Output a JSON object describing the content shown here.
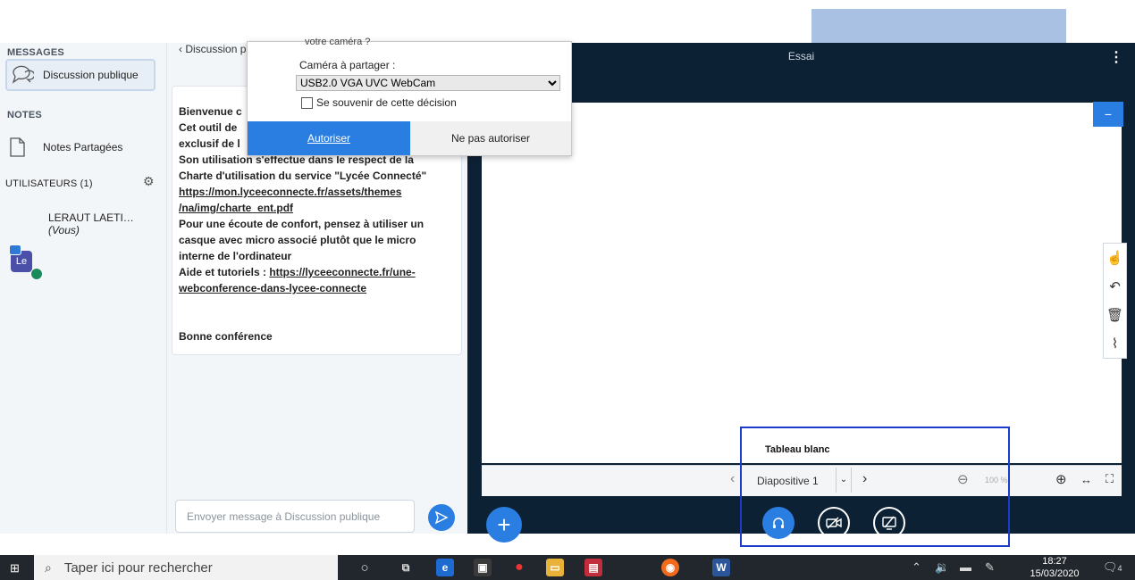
{
  "sidebar": {
    "messages_title": "MESSAGES",
    "public_chat_label": "Discussion publique",
    "notes_title": "NOTES",
    "shared_notes_label": "Notes Partagées",
    "users_title": "UTILISATEURS (1)",
    "user": {
      "initials": "Le",
      "name": "LERAUT LAETI…",
      "you": "(Vous)"
    }
  },
  "chat": {
    "header": "Discussion p",
    "messages": {
      "line1": "Bienvenue c",
      "line2": "Cet outil de",
      "line3": "exclusif de l",
      "line4": "Son utilisation s'effectue dans le respect de la",
      "line5": "Charte d'utilisation du service \"Lycée Connecté\"",
      "link1a": "https://mon.lyceeconnecte.fr/assets/themes",
      "link1b": "/na/img/charte_ent.pdf",
      "line6": "Pour une écoute de confort, pensez à utiliser un",
      "line7": "casque avec micro associé plutôt que le micro",
      "line8": "interne de l'ordinateur",
      "line9_prefix": "Aide et tutoriels : ",
      "link2a": "https://lyceeconnecte.fr/une-",
      "link2b": "webconference-dans-lycee-connecte",
      "closing": "Bonne conférence"
    },
    "input_placeholder": "Envoyer message à Discussion publique"
  },
  "popup": {
    "cut_text": "votre caméra ?",
    "camera_label": "Caméra à partager :",
    "camera_value": "USB2.0 VGA UVC WebCam",
    "remember_label": "Se souvenir de cette décision",
    "allow_label": "Autoriser",
    "deny_label": "Ne pas autoriser"
  },
  "presentation": {
    "title": "Essai",
    "minimize": "−",
    "whiteboard_label": "Tableau blanc",
    "slide_label": "Diapositive 1",
    "zoom": "100 %"
  },
  "taskbar": {
    "search_placeholder": "Taper ici pour rechercher",
    "time": "18:27",
    "date": "15/03/2020",
    "notif_count": "4"
  },
  "colors": {
    "accent": "#2a7de1",
    "dark_panel": "#0d2135",
    "highlight_box": "#1a3cc8"
  }
}
